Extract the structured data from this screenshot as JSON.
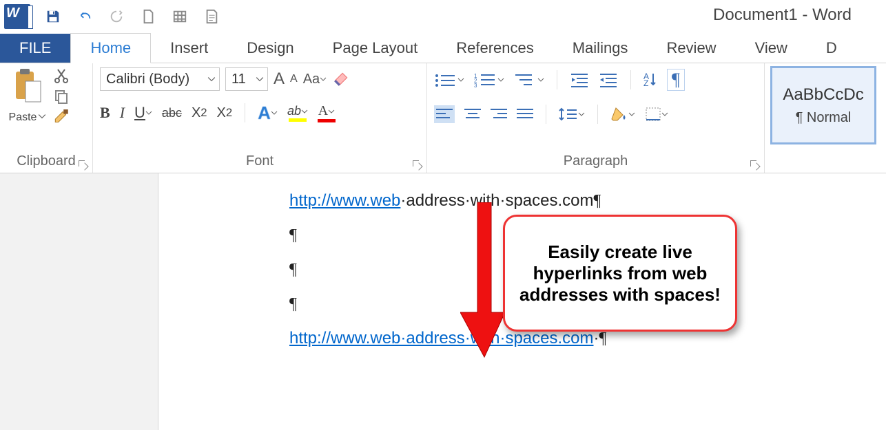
{
  "title": "Document1 - Word",
  "tabs": {
    "file": "FILE",
    "home": "Home",
    "insert": "Insert",
    "design": "Design",
    "pagelayout": "Page Layout",
    "references": "References",
    "mailings": "Mailings",
    "review": "Review",
    "view": "View",
    "more": "D"
  },
  "clipboard": {
    "label": "Clipboard",
    "paste": "Paste"
  },
  "font": {
    "label": "Font",
    "name": "Calibri (Body)",
    "size": "11",
    "increaseA": "A",
    "decreaseA": "A",
    "aa": "Aa",
    "bold": "B",
    "italic": "I",
    "underline": "U",
    "strike": "abc",
    "sub": "X",
    "sup": "X",
    "effects": "A",
    "highlight": "ab",
    "fontcolor": "A"
  },
  "paragraph": {
    "label": "Paragraph",
    "sortAZ": "A",
    "show": "¶"
  },
  "styles": {
    "normal_preview": "AaBbCcDc",
    "normal_name": "¶ Normal"
  },
  "doc": {
    "line1_link": "http://www.web",
    "line1_rest": "·address·with·spaces.com",
    "p": "¶",
    "line2_link": "http://www.web·address·with·spaces.com",
    "nbsp_dot": "·",
    "callout": "Easily create live hyperlinks from web addresses with spaces!"
  }
}
